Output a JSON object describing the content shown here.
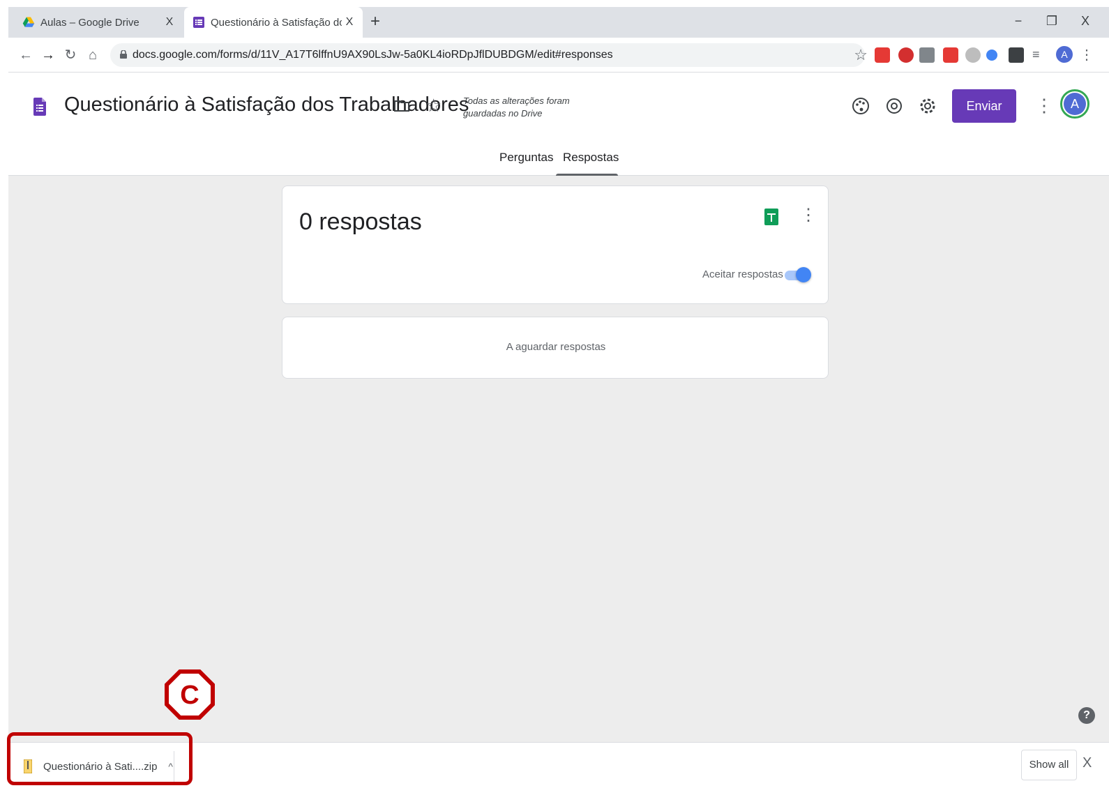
{
  "browser": {
    "tabs": [
      {
        "title": "Aulas – Google Drive",
        "close": "X",
        "active": false
      },
      {
        "title": "Questionário à Satisfação dos Tra",
        "close": "X",
        "active": true
      }
    ],
    "new_tab": "+",
    "window_controls": {
      "minimize": "−",
      "restore": "❐",
      "close": "X"
    },
    "url": "docs.google.com/forms/d/11V_A17T6lffnU9AX90LsJw-5a0KL4ioRDpJflDUBDGM/edit#responses",
    "profile_initial": "A"
  },
  "form": {
    "title": "Questionário à Satisfação dos Trabalhadores",
    "saved_note": "Todas as alterações foram guardadas no Drive",
    "send_label": "Enviar",
    "profile_initial": "A",
    "tabs": [
      {
        "label": "Perguntas",
        "active": false
      },
      {
        "label": "Respostas",
        "active": true
      }
    ]
  },
  "responses": {
    "count_label": "0 respostas",
    "accept_label": "Aceitar respostas",
    "accepting": true,
    "waiting_label": "A aguardar respostas"
  },
  "callout": {
    "letter": "C",
    "color": "#c00000"
  },
  "downloads": {
    "file_name": "Questionário à Sati....zip",
    "show_all": "Show all",
    "close": "X"
  },
  "colors": {
    "accent": "#673ab7",
    "toggle": "#4285f4",
    "sheets": "#0f9d58",
    "highlight": "#c00000"
  },
  "icons": {
    "nav": [
      "back-arrow-icon",
      "forward-arrow-icon",
      "reload-icon",
      "home-icon"
    ],
    "header": [
      "palette-icon",
      "preview-eye-icon",
      "settings-gear-icon"
    ]
  }
}
